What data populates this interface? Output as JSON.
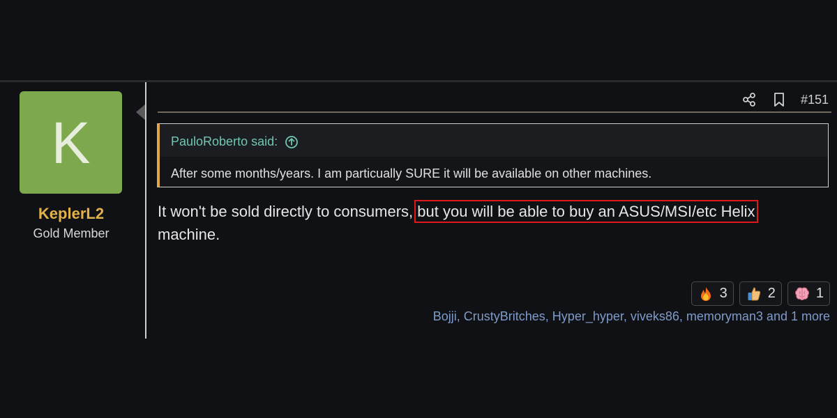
{
  "user": {
    "avatar_letter": "K",
    "name": "KeplerL2",
    "title": "Gold Member",
    "avatar_color": "#7ea84e",
    "name_color": "#e2b14a"
  },
  "post": {
    "number": "#151",
    "header_icons": [
      "share-icon",
      "bookmark-icon"
    ],
    "quote": {
      "author_line": "PauloRoberto said:",
      "text": "After some months/years. I am particually SURE it will be available on other machines."
    },
    "body_part1": "It won't be sold directly to consumers,",
    "body_highlight": "but you will be able to buy an ASUS/MSI/etc Helix",
    "body_part2": "machine.",
    "highlight_color": "#e0181c"
  },
  "reactions": [
    {
      "icon": "fire-icon",
      "count": "3"
    },
    {
      "icon": "thumbs-up-icon",
      "count": "2"
    },
    {
      "icon": "brain-icon",
      "count": "1"
    }
  ],
  "reactors_text": "Bojji, CrustyBritches, Hyper_hyper, viveks86, memoryman3 and 1 more"
}
